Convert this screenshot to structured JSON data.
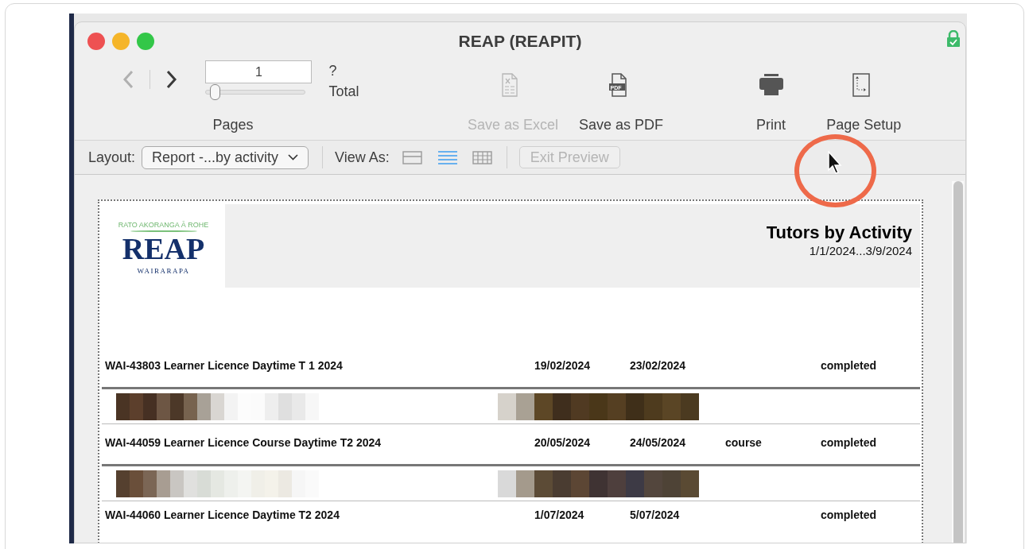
{
  "window": {
    "title": "REAP (REAPIT)"
  },
  "toolbar": {
    "nav": {
      "back_disabled": true,
      "forward_disabled": false
    },
    "page_field": {
      "value": "1"
    },
    "page_slider": {
      "level": 0.05
    },
    "total_count": "?",
    "total_label": "Total",
    "pages_label": "Pages",
    "buttons": [
      {
        "kind": "excel",
        "label": "Save as Excel",
        "disabled": true
      },
      {
        "kind": "pdf",
        "label": "Save as PDF",
        "disabled": false,
        "icon_text": "PDF"
      },
      {
        "kind": "print",
        "label": "Print",
        "disabled": false
      },
      {
        "kind": "page_setup",
        "label": "Page Setup",
        "disabled": false
      }
    ]
  },
  "layout_bar": {
    "layout_label": "Layout:",
    "layout_select": "Report -...by activity",
    "view_as_label": "View As:",
    "view_modes": [
      {
        "kind": "form",
        "selected": false
      },
      {
        "kind": "list",
        "selected": true
      },
      {
        "kind": "table",
        "selected": false
      }
    ],
    "exit_preview": {
      "label": "Exit Preview",
      "disabled": true
    }
  },
  "report": {
    "logo": {
      "tagline": "RATO AKORANGA Ā ROHE",
      "name": "REAP",
      "region": "WAIRARAPA"
    },
    "title": "Tutors by Activity",
    "date_range": "1/1/2024...3/9/2024",
    "activities": [
      {
        "name": "WAI-43803 Learner Licence Daytime T 1 2024",
        "start": "19/02/2024",
        "end": "23/02/2024",
        "status": "completed",
        "tutors_shown": true
      },
      {
        "name": "WAI-44059 Learner Licence Course Daytime T2 2024",
        "start": "20/05/2024",
        "end": "24/05/2024",
        "type": "course",
        "status": "completed",
        "tutors_shown": true
      },
      {
        "name": "WAI-44060 Learner Licence Daytime T2 2024",
        "start": "1/07/2024",
        "end": "5/07/2024",
        "status": "completed",
        "tutors_shown": false
      }
    ]
  }
}
